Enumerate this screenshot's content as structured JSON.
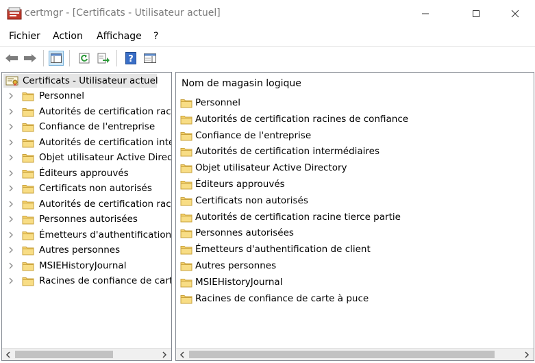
{
  "window": {
    "title": "certmgr - [Certificats - Utilisateur actuel]",
    "minimize_icon": "minimize-icon",
    "maximize_icon": "maximize-icon",
    "close_icon": "close-icon"
  },
  "menu": {
    "items": [
      "Fichier",
      "Action",
      "Affichage",
      "?"
    ]
  },
  "toolbar": {
    "buttons": [
      "back-arrow-icon",
      "forward-arrow-icon",
      "console-tree-icon",
      "refresh-icon",
      "export-list-icon",
      "help-icon",
      "properties-pane-icon"
    ]
  },
  "tree": {
    "root_label": "Certificats - Utilisateur actuel",
    "items": [
      "Personnel",
      "Autorités de certification raci",
      "Confiance de l'entreprise",
      "Autorités de certification inte",
      "Objet utilisateur Active Direct",
      "Éditeurs approuvés",
      "Certificats non autorisés",
      "Autorités de certification raci",
      "Personnes autorisées",
      "Émetteurs d'authentification",
      "Autres personnes",
      "MSIEHistoryJournal",
      "Racines de confiance de carte"
    ]
  },
  "list": {
    "column_header": "Nom de magasin logique",
    "items": [
      "Personnel",
      "Autorités de certification racines de confiance",
      "Confiance de l'entreprise",
      "Autorités de certification intermédiaires",
      "Objet utilisateur Active Directory",
      "Éditeurs approuvés",
      "Certificats non autorisés",
      "Autorités de certification racine tierce partie",
      "Personnes autorisées",
      "Émetteurs d'authentification de client",
      "Autres personnes",
      "MSIEHistoryJournal",
      "Racines de confiance de carte à puce"
    ]
  },
  "colors": {
    "folder": "#f4d06a",
    "selection": "#e5e5e5",
    "toolbar_active": "#cde6f7"
  }
}
